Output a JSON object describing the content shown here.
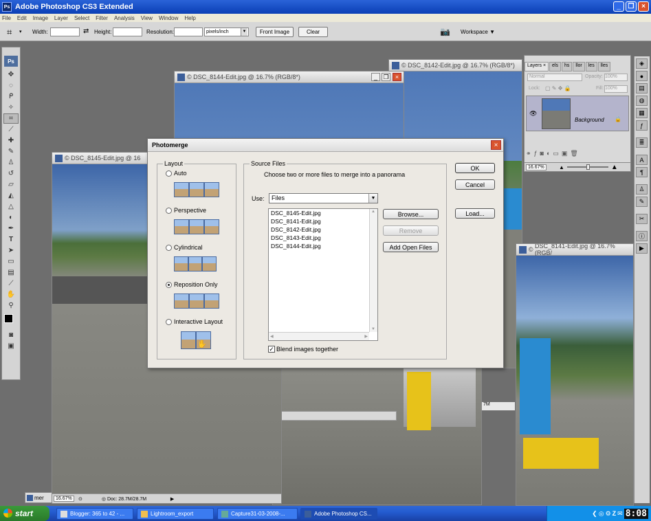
{
  "app": {
    "title": "Adobe Photoshop CS3 Extended",
    "icon": "ps-icon"
  },
  "menu": [
    "File",
    "Edit",
    "Image",
    "Layer",
    "Select",
    "Filter",
    "Analysis",
    "View",
    "Window",
    "Help"
  ],
  "options_bar": {
    "width_label": "Width:",
    "height_label": "Height:",
    "resolution_label": "Resolution:",
    "units_value": "pixels/inch",
    "front_image_label": "Front Image",
    "clear_label": "Clear",
    "workspace_label": "Workspace ▼"
  },
  "toolbox": {
    "logo": "Ps"
  },
  "documents": {
    "d8144": "DSC_8144-Edit.jpg @ 16.7% (RGB/8*)",
    "d8142": "DSC_8142-Edit.jpg @ 16.7% (RGB/8*)",
    "d8145": "DSC_8145-Edit.jpg @ 16",
    "d8141": "DSC_8141-Edit.jpg @ 16.7% (RGB/",
    "status_zoom": "16.67%",
    "status_doc": "Doc: 28.7M/28.7M",
    "minimized": "mer",
    "side_readout": "7M"
  },
  "layers_panel": {
    "tabs": [
      "Layers ×",
      "els",
      "hs",
      "llor",
      "les",
      "lles"
    ],
    "blend_mode": "Normal",
    "opacity_label": "Opacity:",
    "opacity_value": "100%",
    "lock_label": "Lock:",
    "fill_label": "Fill:",
    "fill_value": "100%",
    "layer_name": "Background",
    "zoom": "16.67%"
  },
  "dialog": {
    "title": "Photomerge",
    "layout_label": "Layout",
    "layouts": [
      "Auto",
      "Perspective",
      "Cylindrical",
      "Reposition Only",
      "Interactive Layout"
    ],
    "selected_layout": "Reposition Only",
    "source_files_label": "Source Files",
    "instructions": "Choose two or more files to merge into a panorama",
    "use_label": "Use:",
    "use_value": "Files",
    "files": [
      "DSC_8145-Edit.jpg",
      "DSC_8141-Edit.jpg",
      "DSC_8142-Edit.jpg",
      "DSC_8143-Edit.jpg",
      "DSC_8144-Edit.jpg"
    ],
    "browse_label": "Browse...",
    "remove_label": "Remove",
    "add_open_files_label": "Add Open Files",
    "blend_label": "Blend images together",
    "ok_label": "OK",
    "cancel_label": "Cancel",
    "load_label": "Load..."
  },
  "taskbar": {
    "start_label": "start",
    "tasks": [
      "Blogger: 365 to 42 - ...",
      "Lightroom_export",
      "Capture31-03-2008-...",
      "Adobe Photoshop CS..."
    ],
    "clock": "8:08"
  },
  "colors": {
    "title_blue": "#245cd0",
    "start_green": "#2a7a2a",
    "close_red": "#d9532e"
  }
}
